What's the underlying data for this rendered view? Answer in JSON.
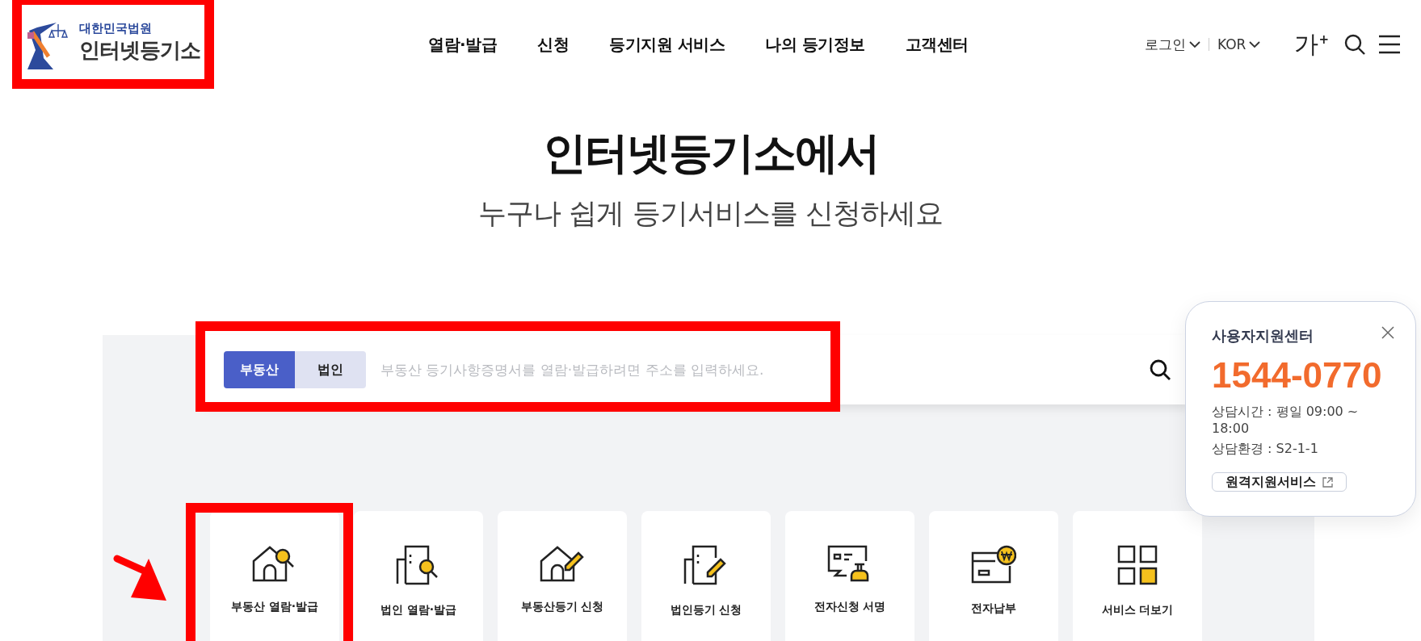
{
  "logo": {
    "org": "대한민국법원",
    "name": "인터넷등기소",
    "highlighted": true
  },
  "nav": [
    {
      "label": "열람·발급"
    },
    {
      "label": "신청"
    },
    {
      "label": "등기지원 서비스"
    },
    {
      "label": "나의 등기정보"
    },
    {
      "label": "고객센터"
    }
  ],
  "utility": {
    "login": "로그인",
    "language": "KOR",
    "font_size": "가$^{+}$"
  },
  "hero": {
    "title": "인터넷등기소에서",
    "subtitle": "누구나 쉽게 등기서비스를 신청하세요"
  },
  "search": {
    "highlighted": true,
    "placeholder": "부동산 등기사항증명서를 열람·발급하려면 주소를 입력하세요.",
    "tabs": [
      {
        "label": "부동산",
        "selected": true
      },
      {
        "label": "법인",
        "selected": false
      }
    ]
  },
  "services": [
    {
      "label": "부동산 열람·발급",
      "kind": "house-search",
      "highlighted": true,
      "pointed": true
    },
    {
      "label": "법인 열람·발급",
      "kind": "building-search",
      "highlighted": false,
      "pointed": false
    },
    {
      "label": "부동산등기 신청",
      "kind": "house-pen",
      "highlighted": false,
      "pointed": false
    },
    {
      "label": "법인등기 신청",
      "kind": "building-pen",
      "highlighted": false,
      "pointed": false
    },
    {
      "label": "전자신청 서명",
      "kind": "sign",
      "highlighted": false,
      "pointed": false
    },
    {
      "label": "전자납부",
      "kind": "pay",
      "highlighted": false,
      "pointed": false
    },
    {
      "label": "서비스 더보기",
      "kind": "more",
      "highlighted": false,
      "pointed": false
    }
  ],
  "support": {
    "title": "사용자지원센터",
    "phone": "1544-0770",
    "hours": "상담시간 : 평일 09:00 ~ 18:00",
    "environment": "상담환경 : S2-1-1",
    "button": "원격지원서비스"
  }
}
